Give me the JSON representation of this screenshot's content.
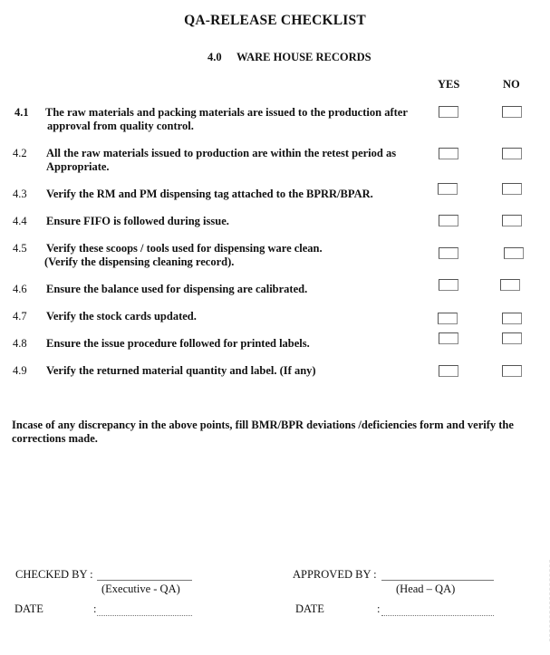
{
  "document": {
    "title": "QA-RELEASE CHECKLIST",
    "section_number": "4.0",
    "section_title": "WARE HOUSE RECORDS",
    "columns": {
      "yes": "YES",
      "no": "NO"
    },
    "items": [
      {
        "num": "4.1",
        "line1": "The raw materials and packing materials are issued to the production after",
        "line2": "approval from quality control."
      },
      {
        "num": "4.2",
        "line1": "All the raw materials issued to production are within the retest period as",
        "line2": "Appropriate."
      },
      {
        "num": "4.3",
        "line1": "Verify the RM and PM dispensing tag attached to the BPRR/BPAR.",
        "line2": ""
      },
      {
        "num": "4.4",
        "line1": "Ensure FIFO is followed during issue.",
        "line2": ""
      },
      {
        "num": "4.5",
        "line1": "Verify these scoops / tools used for dispensing ware clean.",
        "line2": "(Verify the dispensing cleaning record)."
      },
      {
        "num": "4.6",
        "line1": "Ensure the balance used for dispensing are calibrated.",
        "line2": ""
      },
      {
        "num": "4.7",
        "line1": "Verify the stock cards updated.",
        "line2": ""
      },
      {
        "num": "4.8",
        "line1": "Ensure the issue procedure followed for printed labels.",
        "line2": ""
      },
      {
        "num": "4.9",
        "line1": "Verify the returned material quantity and label. (If any)",
        "line2": ""
      }
    ],
    "note": "Incase of any discrepancy in the above points, fill BMR/BPR deviations /deficiencies form and verify the corrections made.",
    "signatures": {
      "checked_by_label": "CHECKED BY :",
      "checked_by_role": "(Executive - QA)",
      "approved_by_label": "APPROVED BY :",
      "approved_by_role": "(Head – QA)",
      "date_label": "DATE",
      "colon": ":"
    }
  }
}
